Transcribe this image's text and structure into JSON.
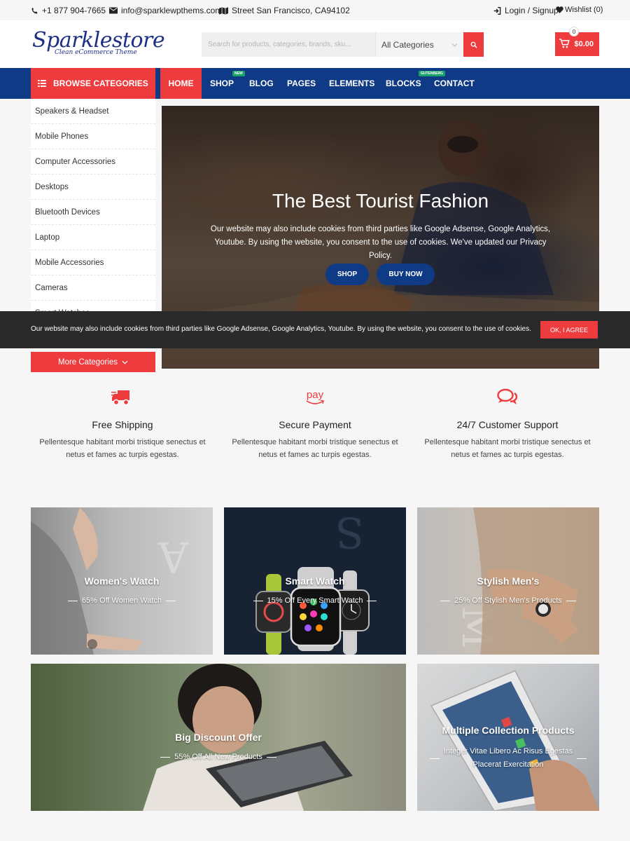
{
  "topbar": {
    "phone": "+1 877 904-7665",
    "email": "info@sparklewpthems.com",
    "address": "Street San Francisco, CA94102",
    "login": "Login / Signup",
    "wishlist": "Wishlist (0)"
  },
  "header": {
    "logo_main": "Sparklestore",
    "logo_sub": "Clean eCommerce Theme",
    "search_placeholder": "Search for products, categories, brands, sku...",
    "search_category": "All Categories",
    "cart_count": "0",
    "cart_total": "$0.00"
  },
  "nav": {
    "browse_label": "BROWSE CATEGORIES",
    "items": [
      {
        "label": "HOME"
      },
      {
        "label": "SHOP",
        "badge": "NEW"
      },
      {
        "label": "BLOG"
      },
      {
        "label": "PAGES"
      },
      {
        "label": "ELEMENTS"
      },
      {
        "label": "BLOCKS",
        "badge": "GUTENBERG"
      },
      {
        "label": "CONTACT"
      }
    ]
  },
  "sidebar": {
    "categories": [
      "Speakers & Headset",
      "Mobile Phones",
      "Computer Accessories",
      "Desktops",
      "Bluetooth Devices",
      "Laptop",
      "Mobile Accessories",
      "Cameras",
      "Smart Watches"
    ],
    "more_label": "More Categories"
  },
  "hero": {
    "title": "The Best Tourist Fashion",
    "text": "Our website may also include cookies from third parties like Google Adsense, Google Analytics, Youtube. By using the website, you consent to the use of cookies. We've updated our Privacy Policy.",
    "btn_shop": "SHOP",
    "btn_buy": "BUY NOW"
  },
  "cookie": {
    "text": "Our website may also include cookies from third parties like Google Adsense, Google Analytics, Youtube. By using the website, you consent to the use of cookies.",
    "button": "OK, I AGREE"
  },
  "features": [
    {
      "title": "Free Shipping",
      "text": "Pellentesque habitant morbi tristique senectus et netus et fames ac turpis egestas.",
      "icon": "truck-icon"
    },
    {
      "title": "Secure Payment",
      "text": "Pellentesque habitant morbi tristique senectus et netus et fames ac turpis egestas.",
      "icon": "pay-icon",
      "icon_text": "pay"
    },
    {
      "title": "24/7 Customer Support",
      "text": "Pellentesque habitant morbi tristique senectus et netus et fames ac turpis egestas.",
      "icon": "chat-icon"
    }
  ],
  "tiles": [
    {
      "title": "Women's Watch",
      "sub": "65% Off Women Watch"
    },
    {
      "title": "Smart Watch",
      "sub": "15% Off Every Smart Watch"
    },
    {
      "title": "Stylish Men's",
      "sub": "25% Off Stylish Men's Products"
    },
    {
      "title": "Big Discount Offer",
      "sub": "55% Off All New Products"
    },
    {
      "title": "Multiple Collection Products",
      "sub_line1": "Integer Vitae Libero Ac Risus Egestas",
      "sub_line2": "Placerat Exercitation"
    }
  ],
  "colors": {
    "accent": "#ee3b3e",
    "nav": "#0f3a85",
    "cookie_bar": "#2a2a2a"
  }
}
